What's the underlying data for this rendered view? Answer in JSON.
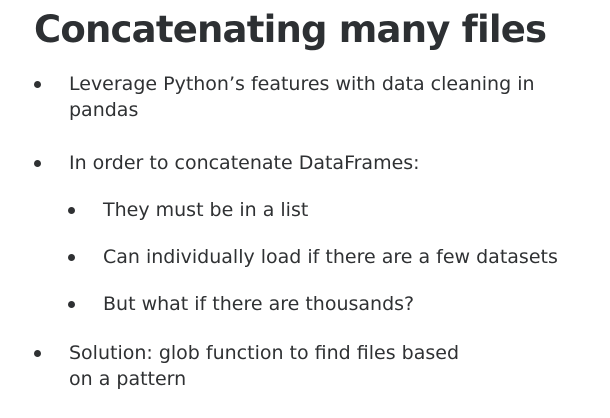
{
  "slide": {
    "title": "Concatenating many files",
    "bullets": [
      {
        "level": 1,
        "lines": [
          "Leverage Python’s features with data cleaning in",
          "pandas"
        ]
      },
      {
        "level": 1,
        "lines": [
          "In order to concatenate DataFrames:"
        ]
      },
      {
        "level": 2,
        "lines": [
          "They must be in a list"
        ]
      },
      {
        "level": 2,
        "lines": [
          "Can individually load if there are a few datasets"
        ]
      },
      {
        "level": 2,
        "lines": [
          "But what if there are thousands?"
        ]
      },
      {
        "level": 1,
        "lines": [
          "Solution: glob function to find files based",
          "on a pattern"
        ]
      }
    ]
  }
}
